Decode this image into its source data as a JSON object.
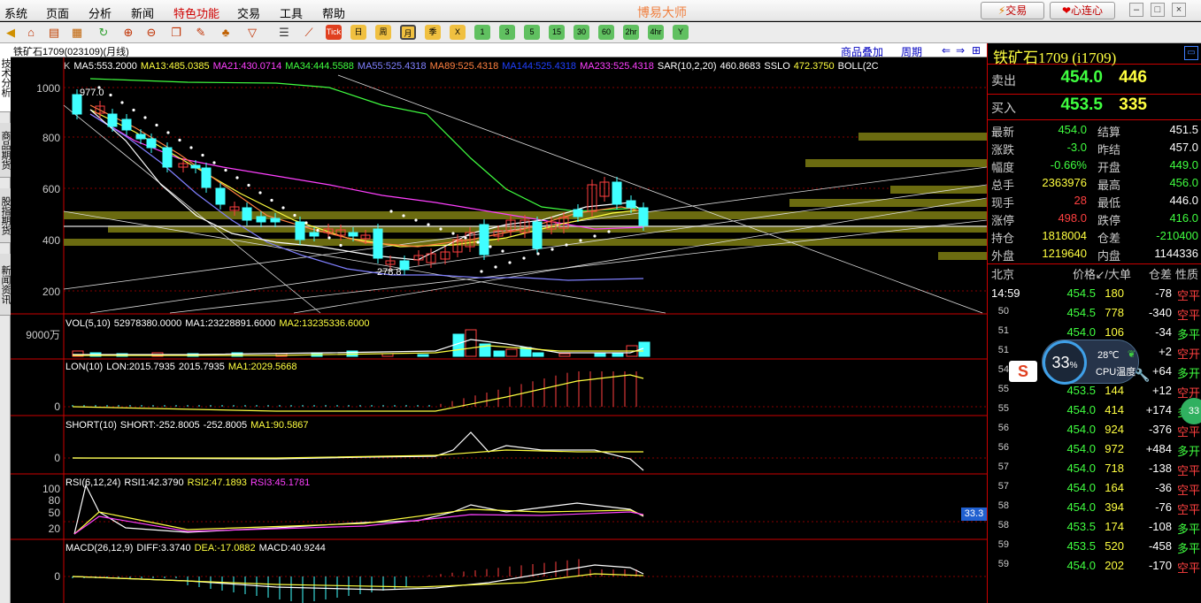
{
  "menu": {
    "items": [
      "系统",
      "页面",
      "分析",
      "新闻",
      "特色功能",
      "交易",
      "工具",
      "帮助"
    ],
    "app_title": "博易大师",
    "trade_btn": "交易",
    "heart_btn": "心连心"
  },
  "toolbar": {
    "period_buttons": [
      "Tick",
      "日",
      "周",
      "月",
      "季",
      "X",
      "1",
      "3",
      "5",
      "15",
      "30",
      "60",
      "2hr",
      "4hr",
      "Y"
    ]
  },
  "left_tabs": [
    "技术分析",
    "商品期货",
    "股指期货",
    "新闻资讯"
  ],
  "chart": {
    "caption": "铁矿石1709(023109)(月线)",
    "link_overlay": "商品叠加",
    "link_period": "周期",
    "kline_legend": [
      {
        "t": "K",
        "c": "#ccc"
      },
      {
        "t": "MA5:553.2000",
        "c": "#fff"
      },
      {
        "t": "MA13:485.0385",
        "c": "#ffff40"
      },
      {
        "t": "MA21:430.0714",
        "c": "#ff40ff"
      },
      {
        "t": "MA34:444.5588",
        "c": "#40ff40"
      },
      {
        "t": "MA55:525.4318",
        "c": "#8080ff"
      },
      {
        "t": "MA89:525.4318",
        "c": "#ff8040"
      },
      {
        "t": "MA144:525.4318",
        "c": "#2040ff"
      },
      {
        "t": "MA233:525.4318",
        "c": "#ff40ff"
      },
      {
        "t": "SAR(10,2,20)",
        "c": "#fff"
      },
      {
        "t": "460.8683",
        "c": "#fff"
      },
      {
        "t": "SSLO",
        "c": "#fff"
      },
      {
        "t": "472.3750",
        "c": "#ffff40"
      },
      {
        "t": "BOLL(2C",
        "c": "#fff"
      }
    ],
    "price_ticks": [
      "1000",
      "800",
      "600",
      "400",
      "200"
    ],
    "high_label": "977.0",
    "low_label": "278.8",
    "vol_legend": [
      {
        "t": "VOL(5,10)",
        "c": "#fff"
      },
      {
        "t": "52978380.0000",
        "c": "#fff"
      },
      {
        "t": "MA1:23228891.6000",
        "c": "#fff"
      },
      {
        "t": "MA2:13235336.6000",
        "c": "#ffff40"
      }
    ],
    "vol_tick": "9000万",
    "lon_legend": [
      {
        "t": "LON(10)",
        "c": "#fff"
      },
      {
        "t": "LON:2015.7935",
        "c": "#fff"
      },
      {
        "t": "2015.7935",
        "c": "#fff"
      },
      {
        "t": "MA1:2029.5668",
        "c": "#ffff40"
      }
    ],
    "short_legend": [
      {
        "t": "SHORT(10)",
        "c": "#fff"
      },
      {
        "t": "SHORT:-252.8005",
        "c": "#fff"
      },
      {
        "t": "-252.8005",
        "c": "#fff"
      },
      {
        "t": "MA1:90.5867",
        "c": "#ffff40"
      }
    ],
    "rsi_legend": [
      {
        "t": "RSI(6,12,24)",
        "c": "#fff"
      },
      {
        "t": "RSI1:42.3790",
        "c": "#fff"
      },
      {
        "t": "RSI2:47.1893",
        "c": "#ffff40"
      },
      {
        "t": "RSI3:45.1781",
        "c": "#ff40ff"
      }
    ],
    "rsi_ticks": [
      "100",
      "80",
      "50",
      "20"
    ],
    "rsi_value_badge": "33.3",
    "macd_legend": [
      {
        "t": "MACD(26,12,9)",
        "c": "#fff"
      },
      {
        "t": "DIFF:3.3740",
        "c": "#fff"
      },
      {
        "t": "DEA:-17.0882",
        "c": "#ffff40"
      },
      {
        "t": "MACD:40.9244",
        "c": "#fff"
      }
    ],
    "zero": "0"
  },
  "quote": {
    "title": "铁矿石1709 (i1709)",
    "sell_label": "卖出",
    "sell_price": "454.0",
    "sell_qty": "446",
    "buy_label": "买入",
    "buy_price": "453.5",
    "buy_qty": "335",
    "stats": [
      [
        "最新",
        "454.0",
        "结算",
        "451.5"
      ],
      [
        "涨跌",
        "-3.0",
        "昨结",
        "457.0"
      ],
      [
        "幅度",
        "-0.66%",
        "开盘",
        "449.0"
      ],
      [
        "总手",
        "2363976",
        "最高",
        "456.0"
      ],
      [
        "现手",
        "28",
        "最低",
        "446.0"
      ],
      [
        "涨停",
        "498.0",
        "跌停",
        "416.0"
      ],
      [
        "持仓",
        "1818004",
        "仓差",
        "-210400"
      ],
      [
        "外盘",
        "1219640",
        "内盘",
        "1144336"
      ]
    ],
    "ticks_header": [
      "北京",
      "价格",
      "↙/大单",
      "仓差",
      "性质"
    ],
    "ticks": [
      [
        "14:59",
        "454.5",
        "180",
        "-78",
        "空平"
      ],
      [
        "50",
        "454.5",
        "778",
        "-340",
        "空平"
      ],
      [
        "51",
        "454.0",
        "106",
        "-34",
        "多平"
      ],
      [
        "51",
        "454.0",
        "",
        "+2",
        "空开"
      ],
      [
        "54",
        "454.0",
        "116",
        "+64",
        "多开"
      ],
      [
        "55",
        "453.5",
        "144",
        "+12",
        "空开"
      ],
      [
        "55",
        "454.0",
        "414",
        "+174",
        "多开"
      ],
      [
        "56",
        "454.0",
        "924",
        "-376",
        "空平"
      ],
      [
        "56",
        "454.0",
        "972",
        "+484",
        "多开"
      ],
      [
        "57",
        "454.0",
        "718",
        "-138",
        "空平"
      ],
      [
        "57",
        "454.0",
        "164",
        "-36",
        "空平"
      ],
      [
        "58",
        "454.0",
        "394",
        "-76",
        "空平"
      ],
      [
        "58",
        "453.5",
        "174",
        "-108",
        "多平"
      ],
      [
        "59",
        "453.5",
        "520",
        "-458",
        "多平"
      ],
      [
        "59",
        "454.0",
        "202",
        "-170",
        "空平"
      ]
    ]
  },
  "cpu": {
    "percent": "33",
    "percent_sign": "%",
    "temp": "28℃",
    "label": "CPU温度"
  }
}
